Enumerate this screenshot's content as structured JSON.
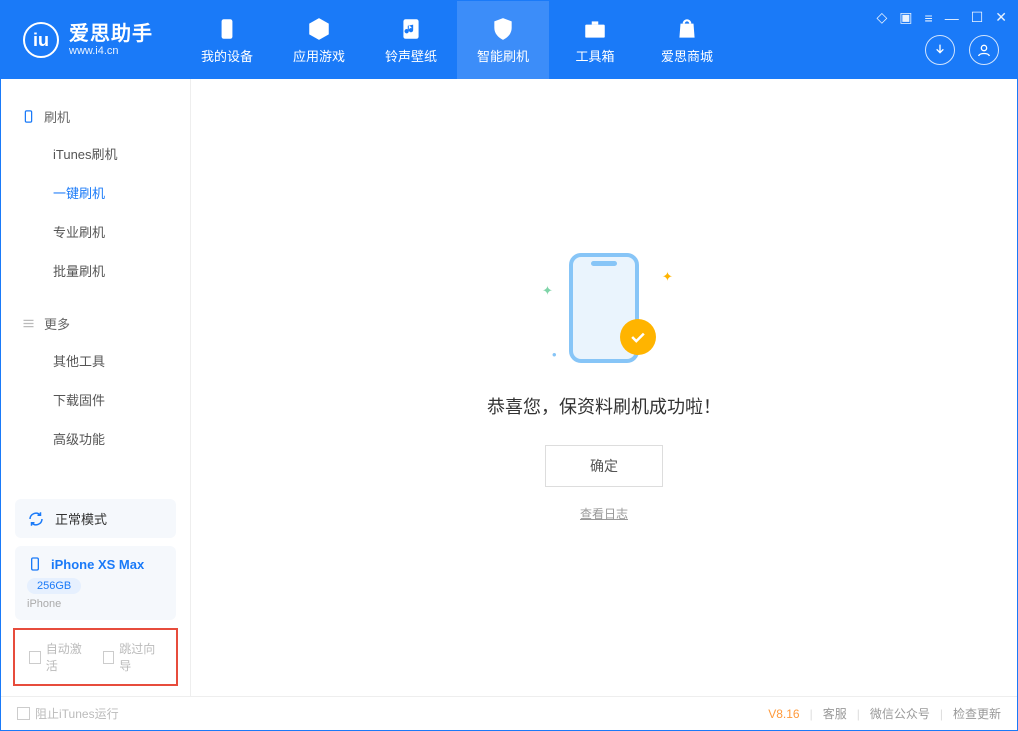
{
  "app": {
    "title": "爱思助手",
    "subtitle": "www.i4.cn"
  },
  "nav": {
    "tabs": [
      {
        "label": "我的设备"
      },
      {
        "label": "应用游戏"
      },
      {
        "label": "铃声壁纸"
      },
      {
        "label": "智能刷机"
      },
      {
        "label": "工具箱"
      },
      {
        "label": "爱思商城"
      }
    ]
  },
  "sidebar": {
    "group1": {
      "title": "刷机",
      "items": [
        "iTunes刷机",
        "一键刷机",
        "专业刷机",
        "批量刷机"
      ]
    },
    "group2": {
      "title": "更多",
      "items": [
        "其他工具",
        "下载固件",
        "高级功能"
      ]
    },
    "mode": "正常模式",
    "device": {
      "name": "iPhone XS Max",
      "storage": "256GB",
      "type": "iPhone"
    },
    "checks": {
      "auto_activate": "自动激活",
      "skip_guide": "跳过向导"
    }
  },
  "main": {
    "success_message": "恭喜您，保资料刷机成功啦！",
    "ok_button": "确定",
    "view_log": "查看日志"
  },
  "status": {
    "block_itunes": "阻止iTunes运行",
    "version": "V8.16",
    "links": [
      "客服",
      "微信公众号",
      "检查更新"
    ]
  }
}
